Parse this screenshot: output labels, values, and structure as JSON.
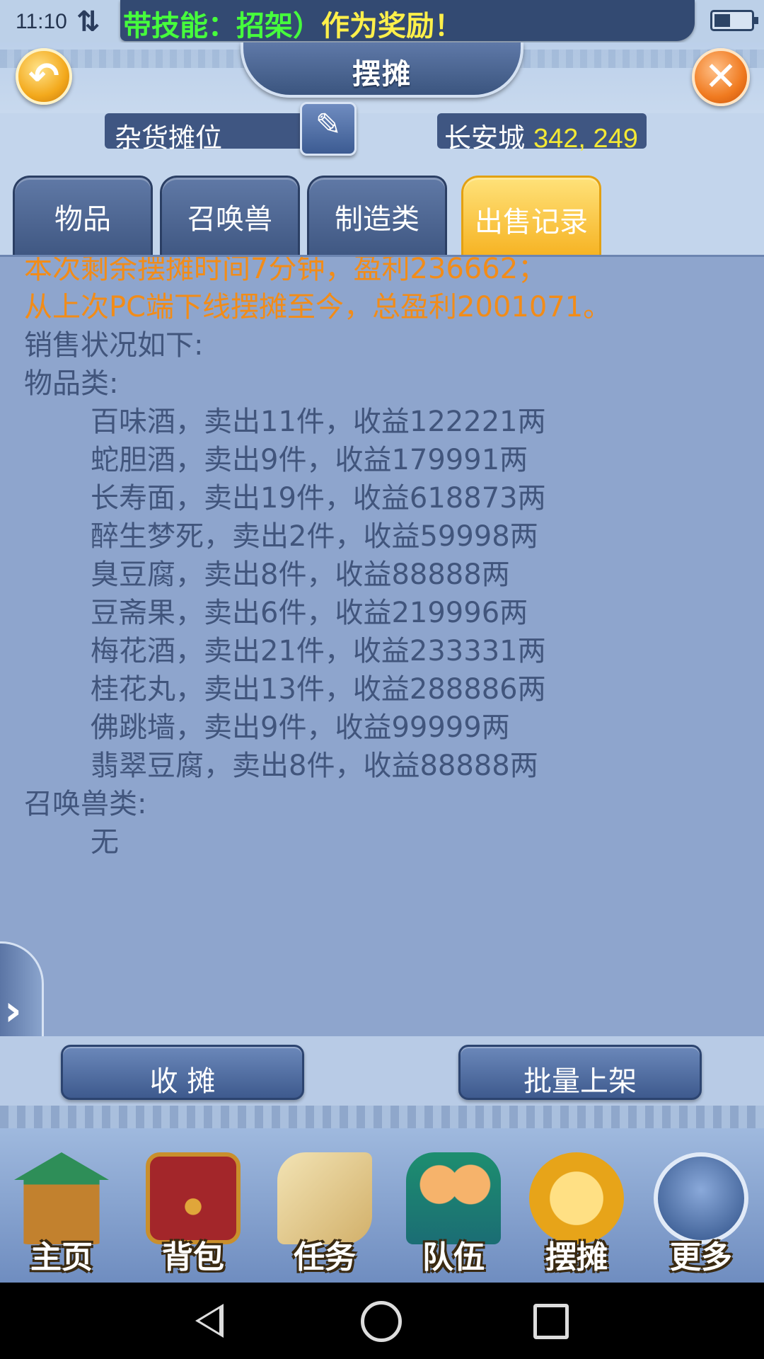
{
  "status_bar": {
    "time": "11:10",
    "marquee_green": "带技能：招架）",
    "marquee_yellow": "作为奖励！"
  },
  "header": {
    "title": "摆摊",
    "back_icon": "back-arrow-icon",
    "close_icon": "close-icon"
  },
  "stall": {
    "name": "杂货摊位",
    "edit_icon": "edit-icon",
    "location_name": "长安城",
    "location_coords": "342, 249"
  },
  "tabs": [
    {
      "label": "物品",
      "active": false
    },
    {
      "label": "召唤兽",
      "active": false
    },
    {
      "label": "制造类",
      "active": false
    },
    {
      "label": "出售记录",
      "active": true
    }
  ],
  "record": {
    "summary_line1": "本次剩余摆摊时间7分钟，盈利236662；",
    "summary_line2": "从上次PC端下线摆摊至今，总盈利2001071。",
    "sales_header": "销售状况如下:",
    "items_header": "物品类:",
    "items": [
      "百味酒，卖出11件，收益122221两",
      "蛇胆酒，卖出9件，收益179991两",
      "长寿面，卖出19件，收益618873两",
      "醉生梦死，卖出2件，收益59998两",
      "臭豆腐，卖出8件，收益88888两",
      "豆斋果，卖出6件，收益219996两",
      "梅花酒，卖出21件，收益233331两",
      "桂花丸，卖出13件，收益288886两",
      "佛跳墙，卖出9件，收益99999两",
      "翡翠豆腐，卖出8件，收益88888两"
    ],
    "pets_header": "召唤兽类:",
    "pets_value": "无"
  },
  "actions": {
    "close_stall": "收 摊",
    "batch_list": "批量上架"
  },
  "dock": [
    {
      "label": "主页",
      "icon": "home-palace-icon"
    },
    {
      "label": "背包",
      "icon": "treasure-chest-icon"
    },
    {
      "label": "任务",
      "icon": "scroll-icon"
    },
    {
      "label": "队伍",
      "icon": "team-icon"
    },
    {
      "label": "摆摊",
      "icon": "coin-stall-icon"
    },
    {
      "label": "更多",
      "icon": "more-icon"
    }
  ],
  "colors": {
    "content_bg": "#8ea5cd",
    "summary_text": "#f28c18",
    "body_text": "#41557c",
    "active_tab": "#f6b323",
    "coords": "#f4e934"
  }
}
